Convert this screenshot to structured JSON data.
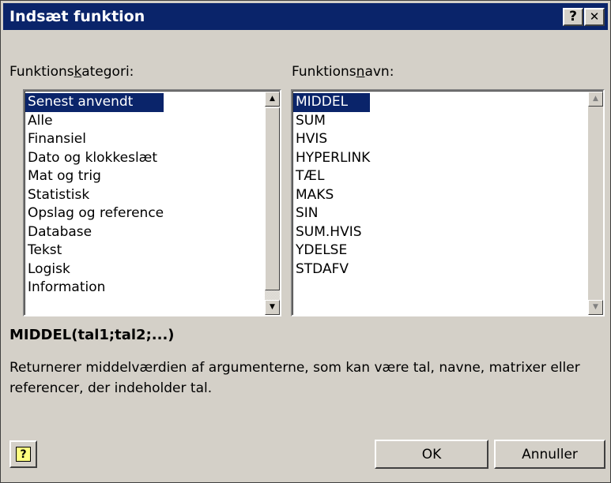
{
  "window": {
    "title": "Indsæt funktion",
    "help_glyph": "?",
    "close_glyph": "✕"
  },
  "category": {
    "label_before": "Funktions",
    "label_accel": "k",
    "label_after": "ategori:",
    "selected_index": 0,
    "items": [
      "Senest anvendt",
      "Alle",
      "Finansiel",
      "Dato og klokkeslæt",
      "Mat og trig",
      "Statistisk",
      "Opslag og reference",
      "Database",
      "Tekst",
      "Logisk",
      "Information"
    ]
  },
  "function_name": {
    "label_before": "Funktions",
    "label_accel": "n",
    "label_after": "avn:",
    "selected_index": 0,
    "items": [
      "MIDDEL",
      "SUM",
      "HVIS",
      "HYPERLINK",
      "TÆL",
      "MAKS",
      "SIN",
      "SUM.HVIS",
      "YDELSE",
      "STDAFV"
    ]
  },
  "details": {
    "signature": "MIDDEL(tal1;tal2;...)",
    "description": "Returnerer middelværdien af argumenterne, som kan være tal, navne, matrixer eller referencer, der indeholder tal."
  },
  "buttons": {
    "help_icon_glyph": "?",
    "ok_label": "OK",
    "cancel_label": "Annuller"
  },
  "icons": {
    "scroll_up": "triangle-up-icon",
    "scroll_down": "triangle-down-icon",
    "help": "help-icon"
  },
  "colors": {
    "title_bar": "#0a246a",
    "selection": "#0a246a",
    "dialog_face": "#d4d0c8"
  }
}
